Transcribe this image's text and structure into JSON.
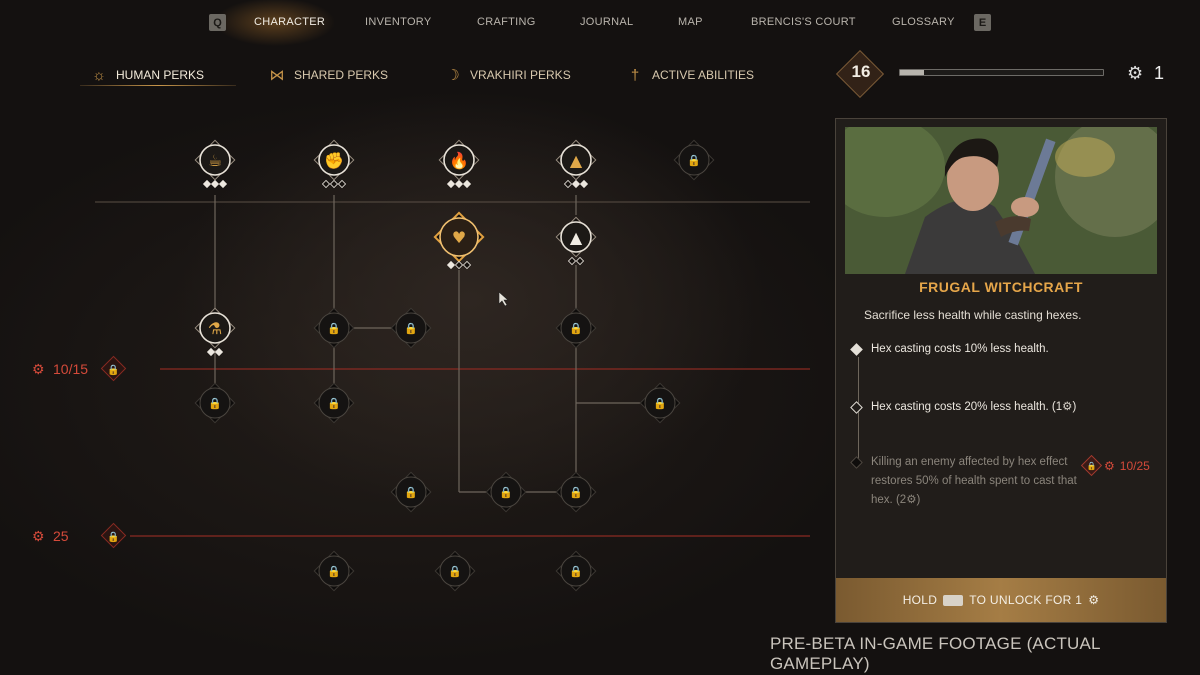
{
  "top_nav": {
    "left_key": "Q",
    "right_key": "E",
    "items": [
      "CHARACTER",
      "INVENTORY",
      "CRAFTING",
      "JOURNAL",
      "MAP",
      "BRENCIS'S COURT",
      "GLOSSARY"
    ],
    "active": "CHARACTER"
  },
  "sub_tabs": {
    "items": [
      {
        "label": "HUMAN PERKS",
        "icon": "sun-icon"
      },
      {
        "label": "SHARED PERKS",
        "icon": "bowtie-icon"
      },
      {
        "label": "VRAKHIRI PERKS",
        "icon": "moon-icon"
      },
      {
        "label": "ACTIVE ABILITIES",
        "icon": "dagger-icon"
      }
    ],
    "active": "HUMAN PERKS"
  },
  "player": {
    "level": "16",
    "xp_progress": 0.12,
    "perk_points": "1"
  },
  "tree": {
    "thresholds": [
      {
        "label": "10/15",
        "color": "#d44a3a"
      },
      {
        "label": "25",
        "color": "#d44a3a"
      }
    ],
    "nodes": [
      {
        "id": "mug",
        "state": "unlocked",
        "glyph": "☕",
        "pips": [
          1,
          1,
          1
        ]
      },
      {
        "id": "fist",
        "state": "unlocked",
        "glyph": "✊",
        "pips": [
          0,
          0,
          0
        ]
      },
      {
        "id": "flame-triangle",
        "state": "unlocked",
        "glyph": "🔥",
        "pips": [
          1,
          1,
          1
        ]
      },
      {
        "id": "triangle-gold",
        "state": "unlocked",
        "glyph": "▲",
        "pips": [
          0,
          1,
          1
        ]
      },
      {
        "id": "locked-top",
        "state": "locked",
        "glyph": "🔒",
        "pips": []
      },
      {
        "id": "frugal-witchcraft",
        "state": "selected",
        "glyph": "♥",
        "pips": [
          1,
          0,
          0
        ]
      },
      {
        "id": "triangle-white",
        "state": "unlocked",
        "glyph": "▲",
        "pips": [
          0,
          0
        ]
      },
      {
        "id": "alchemy",
        "state": "unlocked",
        "glyph": "⚗",
        "pips": [
          1,
          1
        ]
      },
      {
        "id": "locked-r2-2",
        "state": "locked",
        "glyph": "🔒",
        "pips": []
      },
      {
        "id": "locked-r2-3",
        "state": "locked",
        "glyph": "🔒",
        "pips": []
      },
      {
        "id": "locked-r2-4",
        "state": "locked",
        "glyph": "🔒",
        "pips": []
      },
      {
        "id": "locked-r3-1",
        "state": "locked",
        "glyph": "🔒",
        "pips": []
      },
      {
        "id": "locked-r3-2",
        "state": "locked",
        "glyph": "🔒",
        "pips": []
      },
      {
        "id": "locked-r3-3",
        "state": "locked",
        "glyph": "🔒",
        "pips": []
      },
      {
        "id": "locked-r4-1",
        "state": "locked",
        "glyph": "🔒",
        "pips": []
      },
      {
        "id": "locked-r4-2",
        "state": "locked",
        "glyph": "🔒",
        "pips": []
      },
      {
        "id": "locked-r4-3",
        "state": "locked",
        "glyph": "🔒",
        "pips": []
      },
      {
        "id": "locked-r5-1",
        "state": "locked",
        "glyph": "🔒",
        "pips": []
      },
      {
        "id": "locked-r5-2",
        "state": "locked",
        "glyph": "🔒",
        "pips": []
      },
      {
        "id": "locked-r5-3",
        "state": "locked",
        "glyph": "🔒",
        "pips": []
      }
    ]
  },
  "detail": {
    "title": "FRUGAL WITCHCRAFT",
    "description": "Sacrifice less health while casting hexes.",
    "tiers": [
      {
        "text": "Hex casting costs 10% less health.",
        "cost": "",
        "state": "unlocked"
      },
      {
        "text": "Hex casting costs 20% less health.",
        "cost": "(1",
        "cost_close": ")",
        "state": "available"
      },
      {
        "text": "Killing an enemy affected by hex effect restores 50% of health spent to cast that hex.",
        "cost": "(2",
        "cost_close": ")",
        "state": "locked"
      }
    ],
    "tier3_requirement": "10/25",
    "footer": {
      "hold": "HOLD",
      "action": "TO UNLOCK FOR 1"
    }
  },
  "caption": "PRE-BETA IN-GAME FOOTAGE (ACTUAL GAMEPLAY)",
  "colors": {
    "accent_gold": "#c8964a",
    "requirement_red": "#d44a3a",
    "title_gold": "#e6a64a"
  }
}
